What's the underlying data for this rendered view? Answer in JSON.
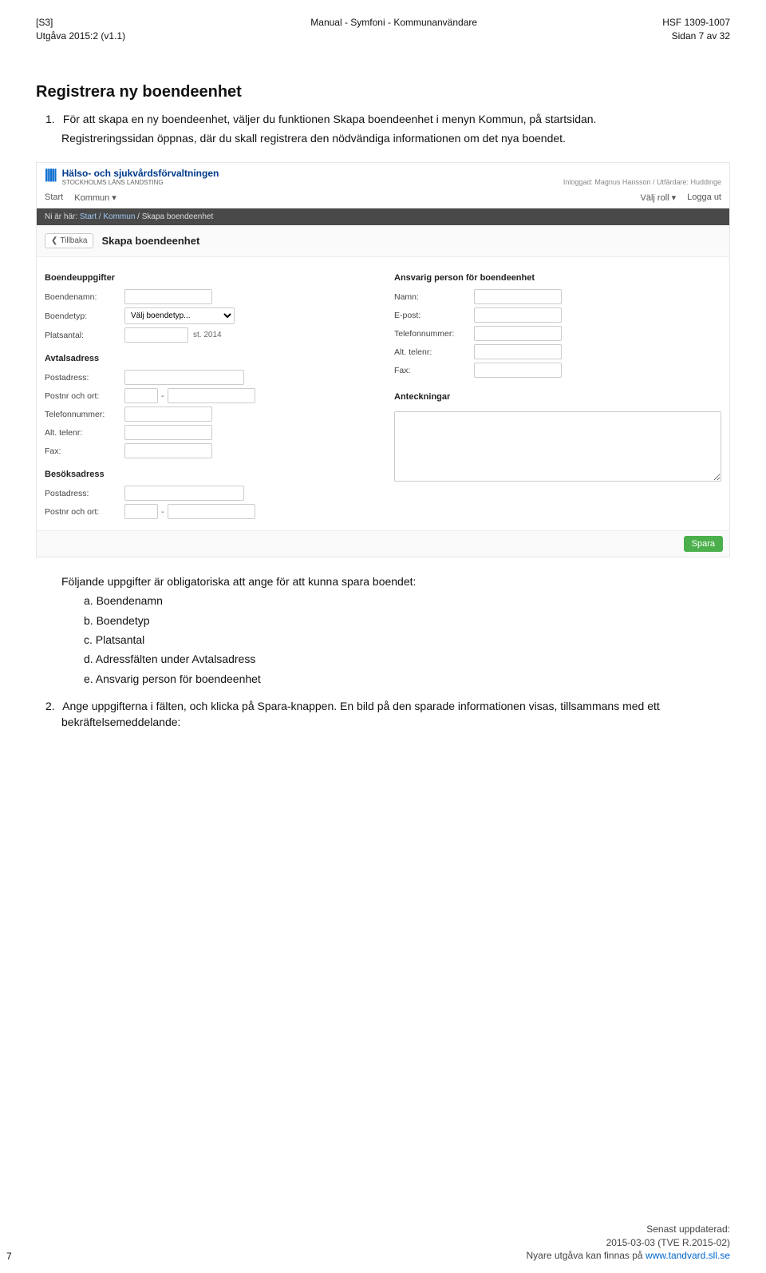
{
  "header": {
    "left_line1": "[S3]",
    "left_line2": "Utgåva 2015:2 (v1.1)",
    "center_line1": "Manual - Symfoni - Kommunanvändare",
    "right_line1": "HSF 1309-1007",
    "right_line2": "Sidan 7 av 32"
  },
  "section_title": "Registrera ny boendeenhet",
  "para1_num": "1.",
  "para1_a": "För att skapa en ny boendeenhet, väljer du funktionen Skapa boendeenhet i menyn Kommun, på startsidan.",
  "para1_b": "Registreringssidan öppnas, där du skall registrera den nödvändiga informationen om det nya boendet.",
  "screenshot": {
    "brand_title": "Hälso- och sjukvårdsförvaltningen",
    "brand_sub": "STOCKHOLMS LÄNS LANDSTING",
    "login_text": "Inloggad: Magnus Hansson / Utfärdare: Huddinge",
    "menu_left": [
      "Start",
      "Kommun ▾"
    ],
    "menu_right": [
      "Välj roll ▾",
      "Logga ut"
    ],
    "crumb_prefix": "Ni är här:",
    "crumb_links": "Start / Kommun",
    "crumb_tail": "/ Skapa boendeenhet",
    "back_label": "Tillbaka",
    "page_title": "Skapa boendeenhet",
    "left_col": {
      "g1": "Boendeuppgifter",
      "boendenamn": "Boendenamn:",
      "boendetyp": "Boendetyp:",
      "boendetyp_placeholder": "Välj boendetyp...",
      "platsantal": "Platsantal:",
      "platsantal_suffix": "st. 2014",
      "g2": "Avtalsadress",
      "postadr": "Postadress:",
      "postnr": "Postnr och ort:",
      "tele": "Telefonnummer:",
      "alt": "Alt. telenr:",
      "fax": "Fax:",
      "g3": "Besöksadress",
      "b_postadr": "Postadress:",
      "b_postnr": "Postnr och ort:"
    },
    "right_col": {
      "g1": "Ansvarig person för boendeenhet",
      "namn": "Namn:",
      "epost": "E-post:",
      "tele": "Telefonnummer:",
      "alt": "Alt. telenr:",
      "fax": "Fax:",
      "g2": "Anteckningar"
    },
    "save_label": "Spara"
  },
  "para2_intro": "Följande uppgifter är obligatoriska att ange för att kunna spara boendet:",
  "list": {
    "a": "a. Boendenamn",
    "b": "b. Boendetyp",
    "c": "c. Platsantal",
    "d": "d. Adressfälten under Avtalsadress",
    "e": "e. Ansvarig person för boendeenhet"
  },
  "para3_num": "2.",
  "para3": "Ange uppgifterna i fälten, och klicka på Spara-knappen. En bild på den sparade informationen visas, tillsammans med ett bekräftelsemeddelande:",
  "footer": {
    "l1": "Senast uppdaterad:",
    "l2": "2015-03-03 (TVE R.2015-02)",
    "l3_pre": "Nyare utgåva kan finnas på ",
    "l3_link": "www.tandvard.sll.se"
  },
  "page_number": "7"
}
